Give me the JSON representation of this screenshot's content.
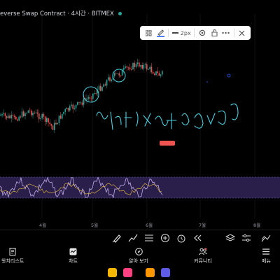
{
  "header": {
    "title": "everse Swap Contract · 4시간 · BITMEX",
    "status_color": "#26a69a"
  },
  "draw_toolbar": {
    "stroke_width": "2px",
    "pen_color": "#2962ff",
    "items": [
      "drag-handle-icon",
      "brush-icon",
      "stroke-width",
      "settings-icon",
      "lock-icon",
      "more-icon",
      "close-icon"
    ]
  },
  "chart": {
    "month_labels": [
      "4월",
      "5월",
      "6월",
      "7월",
      "8월"
    ],
    "price_tag": "",
    "colors": {
      "up": "#26a69a",
      "down": "#ef5350",
      "rsi": "#b39ddb",
      "rsi_band": "#2a1f4a",
      "drawing": "#4dd0e1"
    }
  },
  "tools_bar": {
    "items": [
      "brush-icon",
      "trend-line-icon",
      "fib-icon",
      "plus-icon",
      "alert-clock-icon",
      "replay-icon",
      "layers-icon",
      "sliders-icon",
      "compare-icon"
    ]
  },
  "nav": {
    "items": [
      {
        "label": "왓치리스트",
        "icon": "watchlist-icon"
      },
      {
        "label": "차트",
        "icon": "chart-icon"
      },
      {
        "label": "알아 보기",
        "icon": "compass-icon"
      },
      {
        "label": "커뮤니티",
        "icon": "community-icon"
      },
      {
        "label": "메뉴",
        "icon": "menu-icon"
      }
    ]
  },
  "dock": {
    "apps": [
      {
        "name": "app-yellow-icon",
        "color": "#f5b800"
      },
      {
        "name": "app-pink-icon",
        "color": "#ff4081"
      },
      {
        "name": "app-orange-icon",
        "color": "#ff9800"
      },
      {
        "name": "app-purple-icon",
        "color": "#5e5ce6"
      }
    ]
  }
}
